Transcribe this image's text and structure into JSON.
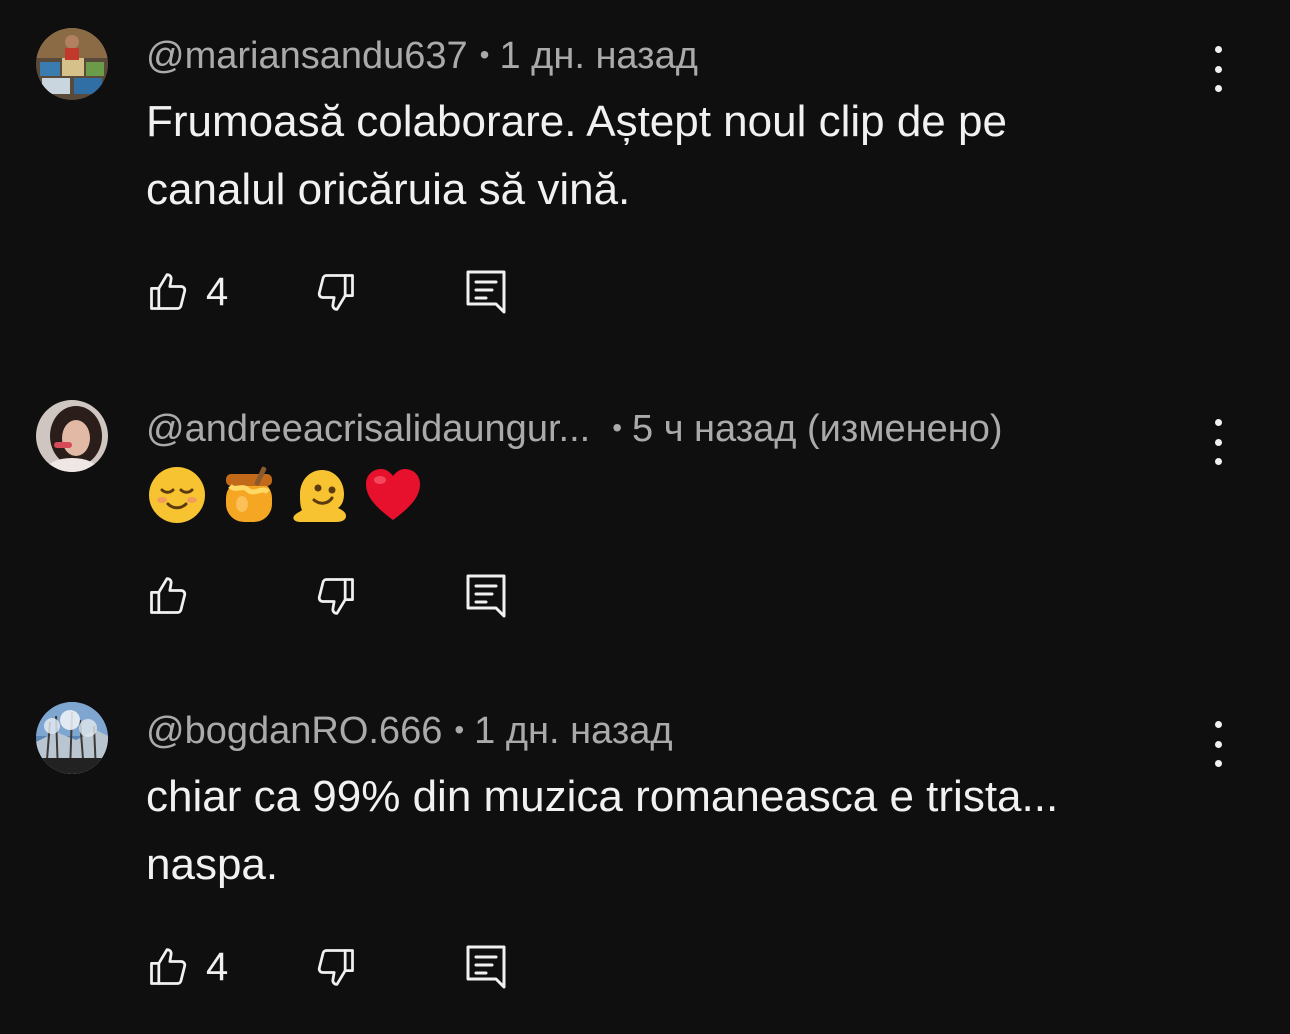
{
  "comments": [
    {
      "author": "@mariansandu637",
      "time": "1 дн. назад",
      "text_lines": [
        "Frumoasă colaborare. Aștept noul clip de pe",
        "canalul oricăruia să vină."
      ],
      "likes": "4",
      "avatar": "avatar-photo-paintings"
    },
    {
      "author": "@andreeacrisalidaungur...",
      "time": "5 ч назад (изменено)",
      "emojis": [
        "relieved-face-emoji",
        "honey-pot-emoji",
        "melting-face-emoji",
        "red-heart-emoji"
      ],
      "likes": "",
      "avatar": "avatar-photo-woman"
    },
    {
      "author": "@bogdanRO.666",
      "time": "1 дн. назад",
      "text_lines": [
        "chiar ca 99% din muzica romaneasca e trista...",
        "naspa."
      ],
      "likes": "4",
      "avatar": "avatar-photo-frosted-trees"
    }
  ],
  "separator": "•",
  "colors": {
    "background": "#0f0f0f",
    "text_primary": "#f1f1f1",
    "text_secondary": "#aaaaaa"
  },
  "icons": [
    "thumb-up-icon",
    "thumb-down-icon",
    "reply-icon",
    "more-vert-icon"
  ]
}
